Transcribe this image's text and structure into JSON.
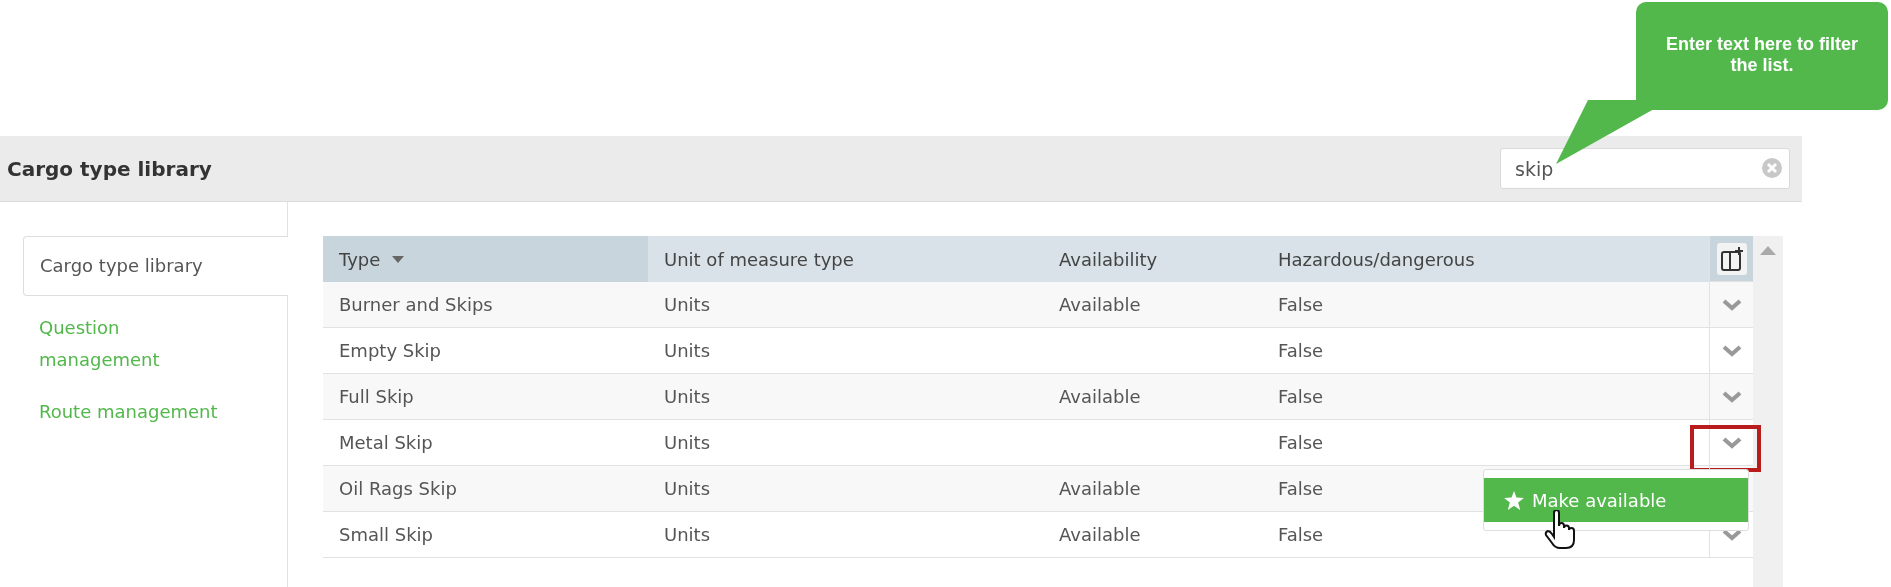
{
  "tooltip": {
    "text": "Enter text here to filter the list."
  },
  "header": {
    "title": "Cargo type library",
    "search": {
      "value": "skip"
    }
  },
  "sidebar": {
    "items": [
      {
        "label": "Cargo type library",
        "selected": true
      },
      {
        "label": "Question management",
        "selected": false
      },
      {
        "label": "Route management",
        "selected": false
      }
    ]
  },
  "table": {
    "columns": [
      {
        "label": "Type",
        "sorted": true
      },
      {
        "label": "Unit of measure type",
        "sorted": false
      },
      {
        "label": "Availability",
        "sorted": false
      },
      {
        "label": "Hazardous/dangerous",
        "sorted": false
      }
    ],
    "rows": [
      {
        "cells": [
          "Burner and Skips",
          "Units",
          "Available",
          "False"
        ],
        "highlighted": false
      },
      {
        "cells": [
          "Empty Skip",
          "Units",
          "",
          "False"
        ],
        "highlighted": false
      },
      {
        "cells": [
          "Full Skip",
          "Units",
          "Available",
          "False"
        ],
        "highlighted": false
      },
      {
        "cells": [
          "Metal Skip",
          "Units",
          "",
          "False"
        ],
        "highlighted": true,
        "menu": {
          "items": [
            "Make available"
          ]
        }
      },
      {
        "cells": [
          "Oil Rags Skip",
          "Units",
          "Available",
          "False"
        ],
        "highlighted": false
      },
      {
        "cells": [
          "Small Skip",
          "Units",
          "Available",
          "False"
        ],
        "highlighted": false
      }
    ]
  }
}
